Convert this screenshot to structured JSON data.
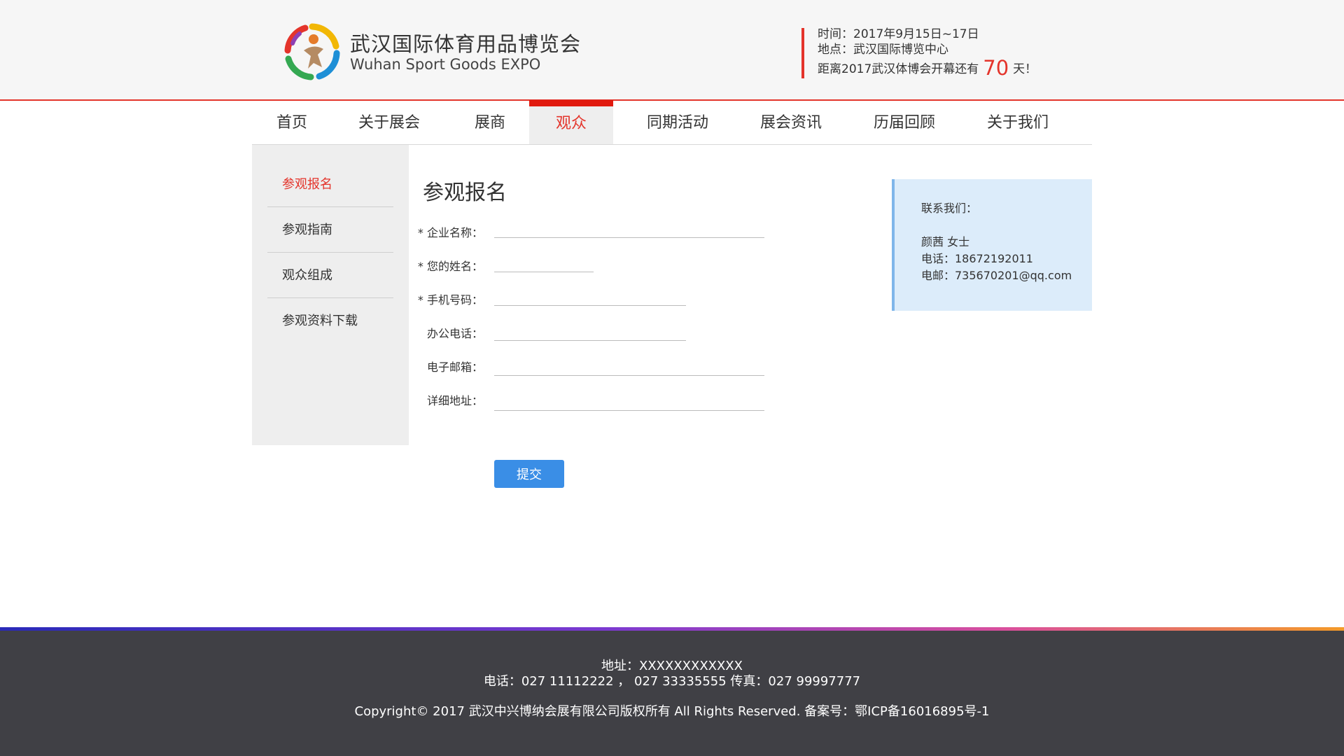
{
  "header": {
    "brand_cn": "武汉国际体育用品博览会",
    "brand_en": "Wuhan Sport Goods EXPO",
    "time": "时间：2017年9月15日~17日",
    "place": "地点：武汉国际博览中心",
    "countdown_prefix": "距离2017武汉体博会开幕还有",
    "countdown_days": "70",
    "countdown_suffix": "天！"
  },
  "nav": {
    "items": [
      "首页",
      "关于展会",
      "展商",
      "观众",
      "同期活动",
      "展会资讯",
      "历届回顾",
      "关于我们"
    ],
    "active": "观众"
  },
  "sidebar": {
    "items": [
      "参观报名",
      "参观指南",
      "观众组成",
      "参观资料下载"
    ],
    "active": "参观报名"
  },
  "form": {
    "title": "参观报名",
    "fields": [
      {
        "label": "* 企业名称：",
        "value": "",
        "required": true
      },
      {
        "label": "* 您的姓名：",
        "value": "",
        "required": true
      },
      {
        "label": "* 手机号码：",
        "value": "",
        "required": true
      },
      {
        "label": "办公电话：",
        "value": "",
        "required": false
      },
      {
        "label": "电子邮箱：",
        "value": "",
        "required": false
      },
      {
        "label": "详细地址：",
        "value": "",
        "required": false
      }
    ],
    "submit_label": "提交"
  },
  "contact": {
    "title": "联系我们：",
    "name": "颜茜 女士",
    "phone": "电话：18672192011",
    "email": "电邮：735670201@qq.com"
  },
  "footer": {
    "address": "地址：XXXXXXXXXXXX",
    "phones": "电话：027 11112222 ，  027 33335555 传真：027 99997777",
    "copyright": "Copyright© 2017 武汉中兴博纳会展有限公司版权所有 All Rights Reserved.  备案号：鄂ICP备16016895号-1"
  },
  "colors": {
    "accent_red": "#e4342b",
    "submit_blue": "#3a8ee6",
    "contact_bg": "#dcecfa",
    "footer_bg": "#404045"
  },
  "icons": {
    "logo": "sport-expo-logo-icon"
  }
}
